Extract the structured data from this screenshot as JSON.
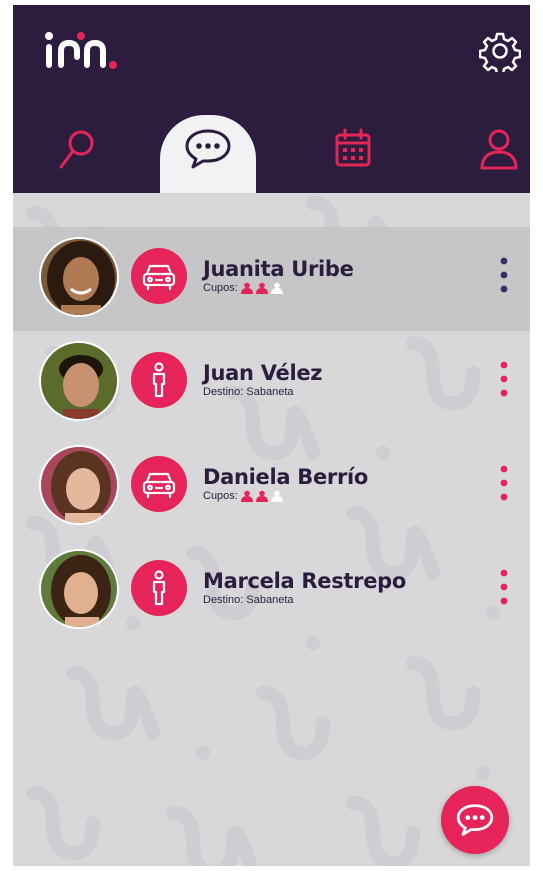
{
  "colors": {
    "header_bg": "#2c1d3e",
    "accent": "#e5245a",
    "text_dark": "#2c1d3e",
    "list_bg": "#d8d7d9",
    "selected_row_bg": "#c6c5c8",
    "menu_dots_selected": "#3a2f63"
  },
  "header": {
    "logo_icon": "brand-logo",
    "settings_icon": "gear-icon",
    "tabs": [
      {
        "icon": "search-icon",
        "active": false
      },
      {
        "icon": "chat-icon",
        "active": true
      },
      {
        "icon": "calendar-icon",
        "active": false
      },
      {
        "icon": "user-icon",
        "active": false
      }
    ]
  },
  "contacts": [
    {
      "name": "Juanita Uribe",
      "role_icon": "car-icon",
      "sub_label": "Cupos:",
      "seats_taken": 2,
      "seats_total": 3,
      "selected": true
    },
    {
      "name": "Juan Vélez",
      "role_icon": "walking-person-icon",
      "sub_label": "Destino: Sabaneta",
      "selected": false
    },
    {
      "name": "Daniela Berrío",
      "role_icon": "car-icon",
      "sub_label": "Cupos:",
      "seats_taken": 2,
      "seats_total": 3,
      "selected": false
    },
    {
      "name": "Marcela Restrepo",
      "role_icon": "walking-person-icon",
      "sub_label": "Destino: Sabaneta",
      "selected": false
    }
  ],
  "fab_icon": "chat-icon"
}
